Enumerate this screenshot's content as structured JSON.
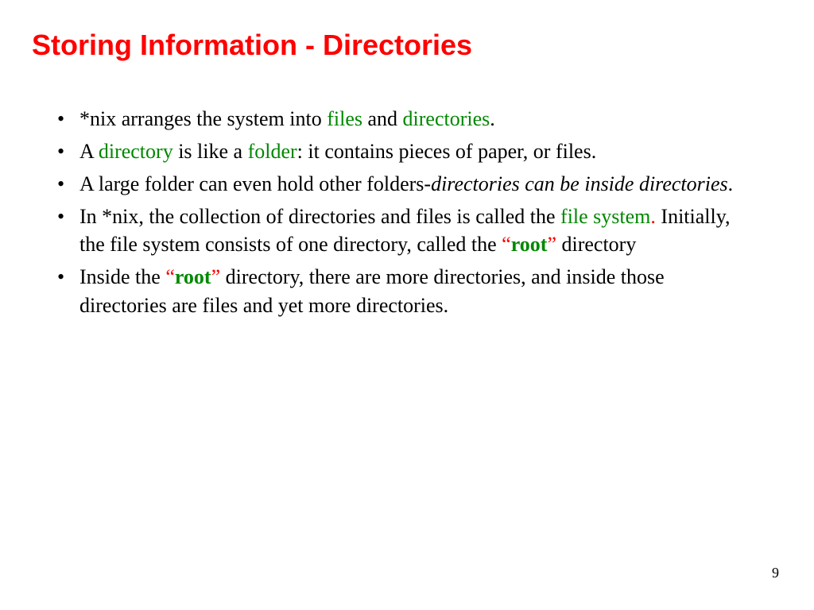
{
  "title": "Storing Information - Directories",
  "page": "9",
  "b1": {
    "a": "*nix arranges the system into ",
    "files": "files",
    "b": " and ",
    "dirs": "directories",
    "c": "."
  },
  "b2": {
    "a": "A ",
    "dir": "directory",
    "b": " is like a ",
    "folder": "folder",
    "c": ": it contains pieces of paper, or files."
  },
  "b3": {
    "a": "A large folder can even hold other folders-",
    "it": "directories can be inside directories",
    "b": "."
  },
  "b4": {
    "a": "In *nix, the collection of directories and files is called the ",
    "fs": "file system",
    "dot": ".",
    "b": "  Initially, the file system consists of one directory, called the ",
    "lq": "“",
    "root": "root",
    "rq": "”",
    "c": " directory"
  },
  "b5": {
    "a": "Inside the ",
    "lq": "“",
    "root": "root",
    "rq": "”",
    "b": " directory, there are more directories, and inside those directories are files and yet more directories."
  }
}
